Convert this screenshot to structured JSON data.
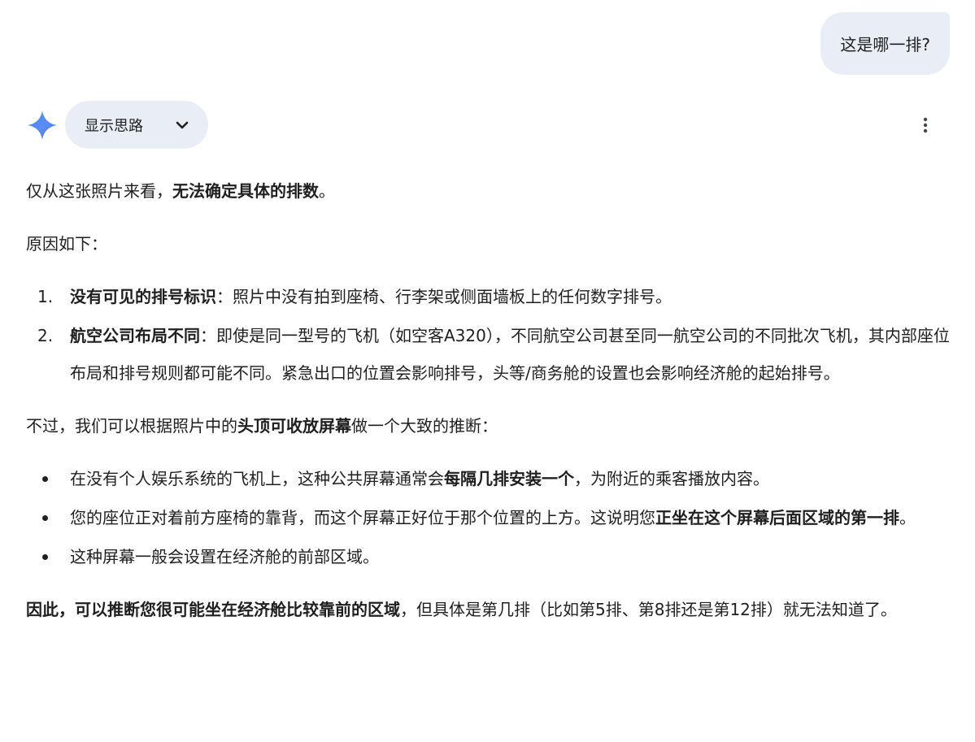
{
  "user_message": "这是哪一排?",
  "thinking_chip": {
    "label": "显示思路"
  },
  "colors": {
    "bubble_bg": "#e9eef6",
    "text": "#1f1f1f",
    "sparkle_blue": "#4285f4"
  },
  "icons": {
    "sparkle": "gemini-sparkle-icon",
    "chevron": "chevron-down-icon",
    "more": "more-vert-icon"
  },
  "response": {
    "p1": {
      "normal": "仅从这张照片来看，",
      "bold": "无法确定具体的排数",
      "tail": "。"
    },
    "p2": "原因如下：",
    "reasons": [
      {
        "num": "1.",
        "bold": "没有可见的排号标识",
        "text": "：照片中没有拍到座椅、行李架或侧面墙板上的任何数字排号。"
      },
      {
        "num": "2.",
        "bold": "航空公司布局不同",
        "text": "：即使是同一型号的飞机（如空客A320），不同航空公司甚至同一航空公司的不同批次飞机，其内部座位布局和排号规则都可能不同。紧急出口的位置会影响排号，头等/商务舱的设置也会影响经济舱的起始排号。"
      }
    ],
    "p3": {
      "normal": "不过，我们可以根据照片中的",
      "bold": "头顶可收放屏幕",
      "tail": "做一个大致的推断："
    },
    "bullets": [
      {
        "pre": "在没有个人娱乐系统的飞机上，这种公共屏幕通常会",
        "bold": "每隔几排安装一个",
        "post": "，为附近的乘客播放内容。"
      },
      {
        "pre": "您的座位正对着前方座椅的靠背，而这个屏幕正好位于那个位置的上方。这说明您",
        "bold": "正坐在这个屏幕后面区域的第一排",
        "post": "。"
      },
      {
        "pre": "这种屏幕一般会设置在经济舱的前部区域。",
        "bold": "",
        "post": ""
      }
    ],
    "conclusion": {
      "bold": "因此，可以推断您很可能坐在经济舱比较靠前的区域",
      "normal": "，但具体是第几排（比如第5排、第8排还是第12排）就无法知道了。"
    }
  }
}
